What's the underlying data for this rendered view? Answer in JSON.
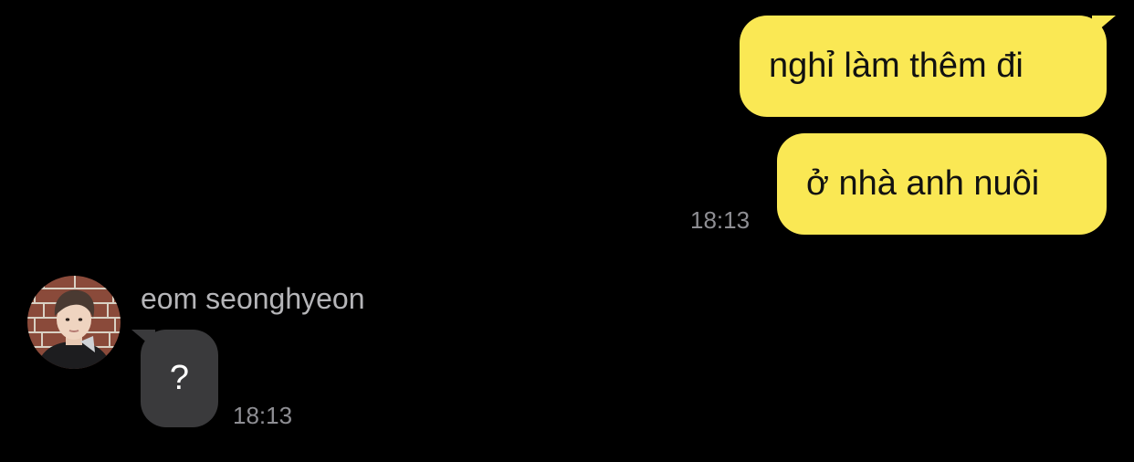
{
  "messages_outgoing": [
    {
      "text": "nghỉ làm thêm đi"
    },
    {
      "text": "ở nhà anh nuôi",
      "time": "18:13"
    }
  ],
  "message_incoming": {
    "sender_name": "eom seonghyeon",
    "text": "?",
    "time": "18:13",
    "avatar_icon": "user-avatar-photo"
  },
  "colors": {
    "background": "#000000",
    "outgoing_bubble": "#fae854",
    "incoming_bubble": "#3a3a3c",
    "timestamp": "#8e8e93"
  }
}
